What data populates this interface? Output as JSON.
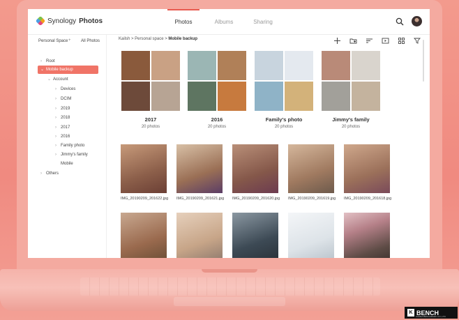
{
  "app": {
    "logo_light": "Synology",
    "logo_bold": "Photos"
  },
  "tabs": [
    {
      "label": "Photos",
      "active": true
    },
    {
      "label": "Albums",
      "active": false
    },
    {
      "label": "Sharing",
      "active": false
    }
  ],
  "sidebar": {
    "personal_space": "Personal Space",
    "all_photos": "All Photos",
    "items": [
      {
        "label": "Root",
        "level": 0,
        "expanded": false
      },
      {
        "label": "Mobile backup",
        "level": 0,
        "expanded": true,
        "selected": true
      },
      {
        "label": "Account",
        "level": 1,
        "expanded": true
      },
      {
        "label": "Devices",
        "level": 2
      },
      {
        "label": "DCIM",
        "level": 2
      },
      {
        "label": "2019",
        "level": 2
      },
      {
        "label": "2018",
        "level": 2
      },
      {
        "label": "2017",
        "level": 2
      },
      {
        "label": "2016",
        "level": 2
      },
      {
        "label": "Family photo",
        "level": 2
      },
      {
        "label": "Jimmy's family",
        "level": 2
      },
      {
        "label": "Mobile",
        "level": 2,
        "leaf": true
      },
      {
        "label": "Others",
        "level": 0
      }
    ]
  },
  "breadcrumb": {
    "path": "Kailsh > Personal space > ",
    "current": "Mobile backup"
  },
  "albums": [
    {
      "name": "2017",
      "count": "20 photos",
      "colors": [
        "#8a5a3c",
        "#c9a184",
        "#6d4a3a",
        "#b7a494"
      ]
    },
    {
      "name": "2016",
      "count": "20 photos",
      "colors": [
        "#9bb6b4",
        "#b08058",
        "#5e7561",
        "#c77a3e"
      ]
    },
    {
      "name": "Family's photo",
      "count": "20 photos",
      "colors": [
        "#c8d4de",
        "#e4e9ef",
        "#8fb3c7",
        "#d3b27a"
      ]
    },
    {
      "name": "Jimmy's family",
      "count": "20 photos",
      "colors": [
        "#b98a78",
        "#d9d4cd",
        "#a2a09a",
        "#c4b39e"
      ]
    }
  ],
  "photos_row1": [
    {
      "file": "IMG_20190209_201622.jpg",
      "color": "#8c5f4a"
    },
    {
      "file": "IMG_20190209_201621.jpg",
      "color": "#9a6f55"
    },
    {
      "file": "IMG_20190209_201620.jpg",
      "color": "#85584a"
    },
    {
      "file": "IMG_20190209_201619.jpg",
      "color": "#a07a60"
    },
    {
      "file": "IMG_20190209_201618.jpg",
      "color": "#9b705a"
    }
  ],
  "photos_row2": [
    {
      "color": "#9a6a4e"
    },
    {
      "color": "#c7a588"
    },
    {
      "color": "#3d4a55"
    },
    {
      "color": "#dde3e8"
    },
    {
      "color": "#5e4c46"
    }
  ],
  "watermark": {
    "brand": "BENCH",
    "k": "K",
    "tagline": "KOREA BENCHMARK CO.,LTD"
  }
}
